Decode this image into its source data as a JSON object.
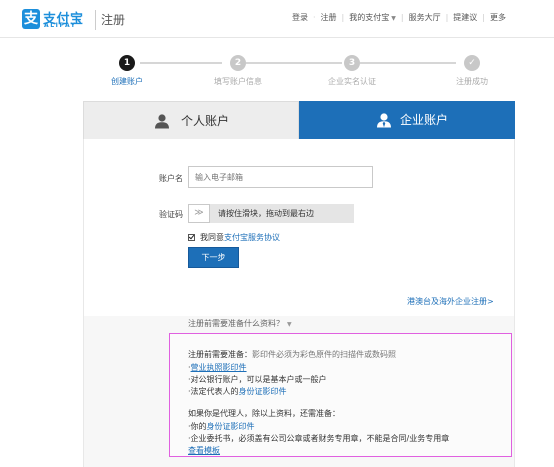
{
  "header": {
    "logo_cn": "支付宝",
    "logo_en": "ALIPAY",
    "page_name": "注册",
    "nav": {
      "login": "登录",
      "register": "注册",
      "my_alipay": "我的支付宝",
      "service_hall": "服务大厅",
      "suggest": "提建议",
      "more": "更多"
    }
  },
  "steps": [
    {
      "num": "1",
      "label": "创建账户"
    },
    {
      "num": "2",
      "label": "填写账户信息"
    },
    {
      "num": "3",
      "label": "企业实名认证"
    },
    {
      "num": "✓",
      "label": "注册成功"
    }
  ],
  "tabs": {
    "personal": "个人账户",
    "company": "企业账户"
  },
  "form": {
    "account_label": "账户名",
    "account_placeholder": "输入电子邮箱",
    "captcha_label": "验证码",
    "slider_handle": "≫",
    "slider_text": "请按住滑块，拖动到最右边",
    "agree_prefix": "我同意",
    "agree_link": "支付宝服务协议",
    "next_button": "下一步",
    "hk_link": "港澳台及海外企业注册>"
  },
  "prep": {
    "toggle": "注册前需要准备什么资料？",
    "intro_prefix": "注册前需要准备：",
    "intro_note": "影印件必须为彩色原件的扫描件或数码照",
    "item1": "营业执照影印件",
    "item2": "对公银行账户，可以是基本户或一般户",
    "item3_prefix": "法定代表人的",
    "item3_link": "身份证影印件",
    "agent_intro": "如果你是代理人，除以上资料，还需准备：",
    "agent1_prefix": "你的",
    "agent1_link": "身份证影印件",
    "agent2_text": "企业委托书，必须盖有公司公章或者财务专用章，不能是合同/业务专用章",
    "agent2_link": "查看模板"
  }
}
